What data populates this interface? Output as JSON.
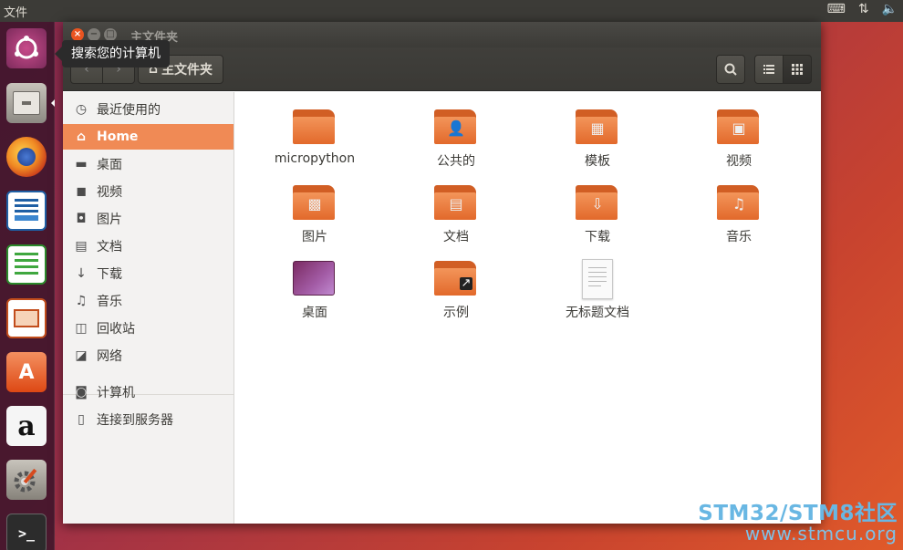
{
  "top_panel": {
    "app_menu": "文件",
    "tray_icons": [
      "keyboard-icon",
      "network-arrows-icon",
      "volume-icon"
    ]
  },
  "launcher": {
    "items": [
      "ubuntu-dash-icon",
      "files-icon",
      "firefox-icon",
      "libreoffice-writer-icon",
      "libreoffice-calc-icon",
      "libreoffice-impress-icon",
      "software-center-icon",
      "amazon-icon",
      "system-settings-icon",
      "terminal-icon"
    ],
    "amazon_glyph": "a",
    "software_glyph": "A",
    "terminal_glyph": ">_"
  },
  "tooltip": {
    "text": "搜索您的计算机"
  },
  "window": {
    "title": "主文件夹",
    "close_glyph": "×",
    "min_glyph": "−",
    "max_glyph": "□",
    "toolbar": {
      "back_glyph": "‹",
      "forward_glyph": "›",
      "path_home_glyph": "⌂",
      "path_label": "主文件夹",
      "search_glyph": "🔍",
      "list_glyph": "☰",
      "grid_glyph": "⋮⋮"
    }
  },
  "sidebar": {
    "items": [
      {
        "label": "最近使用的",
        "icon": "clock-icon",
        "glyph": "◷"
      },
      {
        "label": "Home",
        "icon": "home-icon",
        "glyph": "⌂",
        "active": true
      },
      {
        "label": "桌面",
        "icon": "desktop-folder-icon",
        "glyph": "▬"
      },
      {
        "label": "视频",
        "icon": "video-icon",
        "glyph": "◼"
      },
      {
        "label": "图片",
        "icon": "camera-icon",
        "glyph": "◘"
      },
      {
        "label": "文档",
        "icon": "document-icon",
        "glyph": "▤"
      },
      {
        "label": "下载",
        "icon": "download-icon",
        "glyph": "↓"
      },
      {
        "label": "音乐",
        "icon": "music-icon",
        "glyph": "♫"
      },
      {
        "label": "回收站",
        "icon": "trash-icon",
        "glyph": "◫"
      },
      {
        "label": "网络",
        "icon": "network-icon",
        "glyph": "◪"
      },
      {
        "label": "计算机",
        "icon": "computer-icon",
        "glyph": "◙"
      },
      {
        "label": "连接到服务器",
        "icon": "server-icon",
        "glyph": "▯"
      }
    ]
  },
  "files": [
    {
      "label": "micropython",
      "type": "folder",
      "emblem": ""
    },
    {
      "label": "公共的",
      "type": "folder",
      "emblem": "👤"
    },
    {
      "label": "模板",
      "type": "folder",
      "emblem": "▦"
    },
    {
      "label": "视频",
      "type": "folder",
      "emblem": "▣"
    },
    {
      "label": "图片",
      "type": "folder",
      "emblem": "▩"
    },
    {
      "label": "文档",
      "type": "folder",
      "emblem": "▤"
    },
    {
      "label": "下载",
      "type": "folder",
      "emblem": "⇩"
    },
    {
      "label": "音乐",
      "type": "folder",
      "emblem": "♫"
    },
    {
      "label": "桌面",
      "type": "desktop",
      "emblem": ""
    },
    {
      "label": "示例",
      "type": "folder",
      "emblem": "↗"
    },
    {
      "label": "无标题文档",
      "type": "document",
      "emblem": ""
    }
  ],
  "watermark": {
    "brand": "STM32/STM8社区",
    "url": "www.stmcu.org"
  }
}
